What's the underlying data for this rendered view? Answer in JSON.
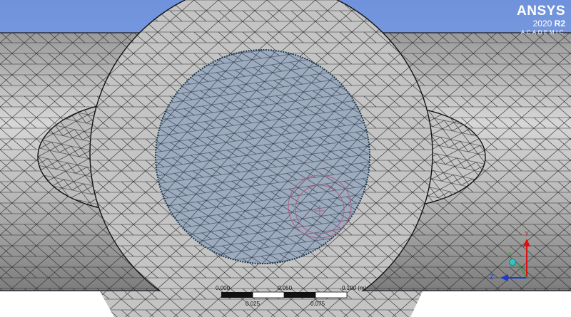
{
  "brand": {
    "name": "ANSYS",
    "version_year": "2020",
    "version_release": "R2",
    "edition": "ACADEMIC"
  },
  "scale_bar": {
    "label_0": "0.000",
    "label_1": "0.025",
    "label_2": "0.050",
    "label_3": "0.075",
    "label_4": "0.100 (m)"
  },
  "triad": {
    "x_label": "X",
    "y_label": "Y",
    "z_label": "Z"
  },
  "colors": {
    "background_top": "#6b8ed8",
    "mesh_fill": "#c2c2c2",
    "selected_face": "#9aa9bd",
    "probe_circle": "#b05a7a"
  }
}
